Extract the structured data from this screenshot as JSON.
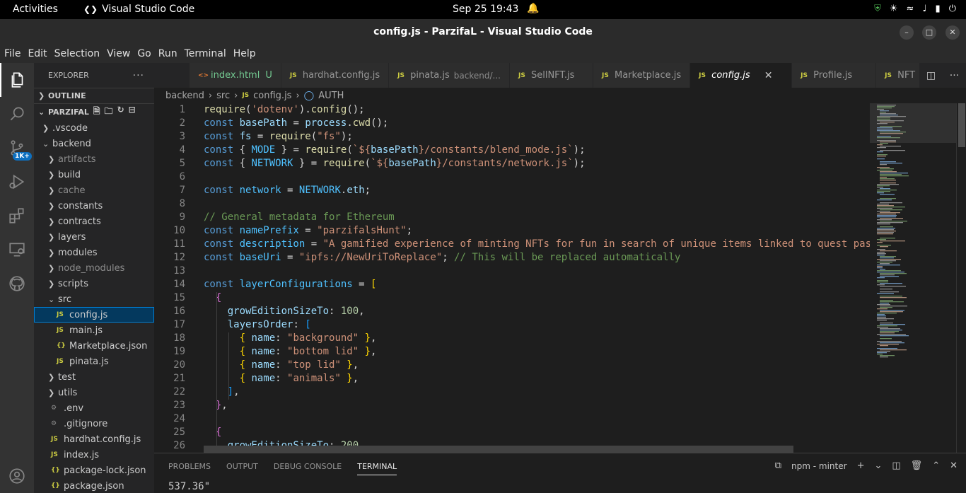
{
  "system_bar": {
    "activities": "Activities",
    "app_name": "Visual Studio Code",
    "clock": "Sep 25  19:43"
  },
  "window": {
    "title": "config.js - ParzifaL - Visual Studio Code"
  },
  "menu": [
    "File",
    "Edit",
    "Selection",
    "View",
    "Go",
    "Run",
    "Terminal",
    "Help"
  ],
  "activity_bar": {
    "source_control_badge": "1K+"
  },
  "explorer": {
    "header": "EXPLORER",
    "outline_label": "OUTLINE",
    "project_label": "PARZIFAL",
    "tree": [
      {
        "label": ".vscode",
        "type": "folder",
        "open": false
      },
      {
        "label": "backend",
        "type": "folder",
        "open": true
      },
      {
        "label": "artifacts",
        "type": "folder",
        "open": false,
        "dim": true
      },
      {
        "label": "build",
        "type": "folder",
        "open": false
      },
      {
        "label": "cache",
        "type": "folder",
        "open": false,
        "dim": true
      },
      {
        "label": "constants",
        "type": "folder",
        "open": false
      },
      {
        "label": "contracts",
        "type": "folder",
        "open": false
      },
      {
        "label": "layers",
        "type": "folder",
        "open": false
      },
      {
        "label": "modules",
        "type": "folder",
        "open": false
      },
      {
        "label": "node_modules",
        "type": "folder",
        "open": false,
        "dim": true
      },
      {
        "label": "scripts",
        "type": "folder",
        "open": false
      },
      {
        "label": "src",
        "type": "folder",
        "open": true
      },
      {
        "label": "config.js",
        "type": "js",
        "selected": true
      },
      {
        "label": "main.js",
        "type": "js"
      },
      {
        "label": "Marketplace.json",
        "type": "json"
      },
      {
        "label": "pinata.js",
        "type": "js"
      },
      {
        "label": "test",
        "type": "folder",
        "open": false
      },
      {
        "label": "utils",
        "type": "folder",
        "open": false
      },
      {
        "label": ".env",
        "type": "env"
      },
      {
        "label": ".gitignore",
        "type": "env"
      },
      {
        "label": "hardhat.config.js",
        "type": "js"
      },
      {
        "label": "index.js",
        "type": "js"
      },
      {
        "label": "package-lock.json",
        "type": "json"
      },
      {
        "label": "package.json",
        "type": "json"
      }
    ]
  },
  "tabs": [
    {
      "label": "index.html",
      "icon": "<>",
      "modified": "U"
    },
    {
      "label": "hardhat.config.js",
      "icon": "JS"
    },
    {
      "label": "pinata.js",
      "icon": "JS",
      "description": "backend/..."
    },
    {
      "label": "SellNFT.js",
      "icon": "JS"
    },
    {
      "label": "Marketplace.js",
      "icon": "JS"
    },
    {
      "label": "config.js",
      "icon": "JS",
      "active": true
    },
    {
      "label": "Profile.js",
      "icon": "JS"
    },
    {
      "label": "NFT",
      "icon": "JS"
    }
  ],
  "breadcrumb": {
    "parts": [
      "backend",
      "src",
      "config.js",
      "AUTH"
    ],
    "file_icon": "JS"
  },
  "editor": {
    "line_numbers": [
      "1",
      "2",
      "3",
      "4",
      "5",
      "6",
      "7",
      "8",
      "9",
      "10",
      "11",
      "12",
      "13",
      "14",
      "15",
      "16",
      "17",
      "18",
      "19",
      "20",
      "21",
      "22",
      "23",
      "24",
      "25",
      "26"
    ],
    "lines": [
      [
        [
          "f",
          "require"
        ],
        [
          "p",
          "("
        ],
        [
          "s",
          "'dotenv'"
        ],
        [
          "p",
          ")."
        ],
        [
          "f",
          "config"
        ],
        [
          "p",
          "();"
        ]
      ],
      [
        [
          "k",
          "const "
        ],
        [
          "v",
          "basePath"
        ],
        [
          "p",
          " = "
        ],
        [
          "v",
          "process"
        ],
        [
          "p",
          "."
        ],
        [
          "f",
          "cwd"
        ],
        [
          "p",
          "();"
        ]
      ],
      [
        [
          "k",
          "const "
        ],
        [
          "v",
          "fs"
        ],
        [
          "p",
          " = "
        ],
        [
          "f",
          "require"
        ],
        [
          "p",
          "("
        ],
        [
          "s",
          "\"fs\""
        ],
        [
          "p",
          ");"
        ]
      ],
      [
        [
          "k",
          "const "
        ],
        [
          "p",
          "{ "
        ],
        [
          "cst",
          "MODE"
        ],
        [
          "p",
          " } = "
        ],
        [
          "f",
          "require"
        ],
        [
          "p",
          "("
        ],
        [
          "s",
          "`${"
        ],
        [
          "v",
          "basePath"
        ],
        [
          "s",
          "}/constants/blend_mode.js`"
        ],
        [
          "p",
          ");"
        ]
      ],
      [
        [
          "k",
          "const "
        ],
        [
          "p",
          "{ "
        ],
        [
          "cst",
          "NETWORK"
        ],
        [
          "p",
          " } = "
        ],
        [
          "f",
          "require"
        ],
        [
          "p",
          "("
        ],
        [
          "s",
          "`${"
        ],
        [
          "v",
          "basePath"
        ],
        [
          "s",
          "}/constants/network.js`"
        ],
        [
          "p",
          ");"
        ]
      ],
      [],
      [
        [
          "k",
          "const "
        ],
        [
          "cst",
          "network"
        ],
        [
          "p",
          " = "
        ],
        [
          "cst",
          "NETWORK"
        ],
        [
          "p",
          "."
        ],
        [
          "v",
          "eth"
        ],
        [
          "p",
          ";"
        ]
      ],
      [],
      [
        [
          "c",
          "// General metadata for Ethereum"
        ]
      ],
      [
        [
          "k",
          "const "
        ],
        [
          "cst",
          "namePrefix"
        ],
        [
          "p",
          " = "
        ],
        [
          "s",
          "\"parzifalsHunt\""
        ],
        [
          "p",
          ";"
        ]
      ],
      [
        [
          "k",
          "const "
        ],
        [
          "cst",
          "description"
        ],
        [
          "p",
          " = "
        ],
        [
          "s",
          "\"A gamified experience of minting NFTs for fun in search of unique items linked to quest pas"
        ]
      ],
      [
        [
          "k",
          "const "
        ],
        [
          "cst",
          "baseUri"
        ],
        [
          "p",
          " = "
        ],
        [
          "s",
          "\"ipfs://NewUriToReplace\""
        ],
        [
          "p",
          "; "
        ],
        [
          "c",
          "// This will be replaced automatically"
        ]
      ],
      [],
      [
        [
          "k",
          "const "
        ],
        [
          "cst",
          "layerConfigurations"
        ],
        [
          "p",
          " = "
        ],
        [
          "b1",
          "["
        ]
      ],
      [
        [
          "p",
          "  "
        ],
        [
          "b2",
          "{"
        ]
      ],
      [
        [
          "p",
          "    "
        ],
        [
          "v",
          "growEditionSizeTo"
        ],
        [
          "p",
          ": "
        ],
        [
          "n",
          "100"
        ],
        [
          "p",
          ","
        ]
      ],
      [
        [
          "p",
          "    "
        ],
        [
          "v",
          "layersOrder"
        ],
        [
          "p",
          ": "
        ],
        [
          "b3",
          "["
        ]
      ],
      [
        [
          "p",
          "      "
        ],
        [
          "b1",
          "{ "
        ],
        [
          "v",
          "name"
        ],
        [
          "p",
          ": "
        ],
        [
          "s",
          "\"background\""
        ],
        [
          "b1",
          " }"
        ],
        [
          "p",
          ","
        ]
      ],
      [
        [
          "p",
          "      "
        ],
        [
          "b1",
          "{ "
        ],
        [
          "v",
          "name"
        ],
        [
          "p",
          ": "
        ],
        [
          "s",
          "\"bottom lid\""
        ],
        [
          "b1",
          " }"
        ],
        [
          "p",
          ","
        ]
      ],
      [
        [
          "p",
          "      "
        ],
        [
          "b1",
          "{ "
        ],
        [
          "v",
          "name"
        ],
        [
          "p",
          ": "
        ],
        [
          "s",
          "\"top lid\""
        ],
        [
          "b1",
          " }"
        ],
        [
          "p",
          ","
        ]
      ],
      [
        [
          "p",
          "      "
        ],
        [
          "b1",
          "{ "
        ],
        [
          "v",
          "name"
        ],
        [
          "p",
          ": "
        ],
        [
          "s",
          "\"animals\""
        ],
        [
          "b1",
          " }"
        ],
        [
          "p",
          ","
        ]
      ],
      [
        [
          "p",
          "    "
        ],
        [
          "b3",
          "]"
        ],
        [
          "p",
          ","
        ]
      ],
      [
        [
          "p",
          "  "
        ],
        [
          "b2",
          "}"
        ],
        [
          "p",
          ","
        ]
      ],
      [],
      [
        [
          "p",
          "  "
        ],
        [
          "b2",
          "{"
        ]
      ],
      [
        [
          "p",
          "    "
        ],
        [
          "v",
          "growEditionSizeTo"
        ],
        [
          "p",
          ": "
        ],
        [
          "n",
          "200"
        ],
        [
          "p",
          ","
        ]
      ]
    ]
  },
  "panel": {
    "tabs": [
      "PROBLEMS",
      "OUTPUT",
      "DEBUG CONSOLE",
      "TERMINAL"
    ],
    "active_tab": "TERMINAL",
    "terminal_name": "npm - minter",
    "output_line": "537.36\""
  },
  "colors": {
    "keyword": "#569cd6",
    "string": "#ce9178",
    "comment": "#6a9955",
    "number": "#b5cea8",
    "selection": "#04395e"
  }
}
